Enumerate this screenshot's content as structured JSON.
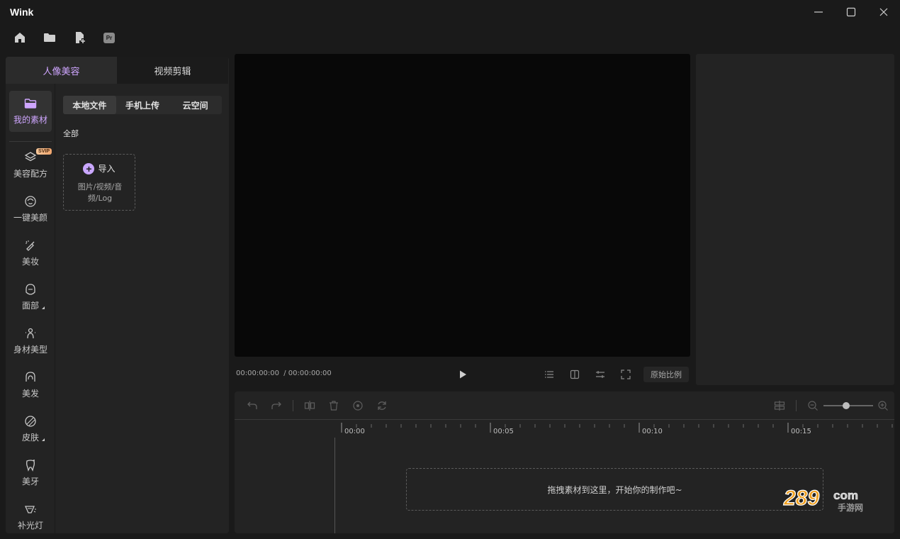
{
  "app": {
    "title": "Wink"
  },
  "window": {
    "minimize": "minimize",
    "maximize": "maximize",
    "close": "close"
  },
  "toolbar": {
    "icons": [
      "home-icon",
      "folder-icon",
      "new-file-icon",
      "premiere-icon"
    ],
    "pr_label": "Pr"
  },
  "top_tabs": [
    {
      "label": "人像美容",
      "active": true
    },
    {
      "label": "视频剪辑",
      "active": false
    }
  ],
  "sidebar": {
    "items": [
      {
        "label": "我的素材",
        "icon": "folder-open-icon",
        "active": true
      },
      {
        "label": "美容配方",
        "icon": "layers-icon",
        "badge": "SVIP"
      },
      {
        "label": "一键美颜",
        "icon": "face-icon"
      },
      {
        "label": "美妆",
        "icon": "makeup-brush-icon"
      },
      {
        "label": "面部",
        "icon": "face-outline-icon"
      },
      {
        "label": "身材美型",
        "icon": "body-icon"
      },
      {
        "label": "美发",
        "icon": "hair-icon"
      },
      {
        "label": "皮肤",
        "icon": "skin-icon"
      },
      {
        "label": "美牙",
        "icon": "tooth-icon"
      },
      {
        "label": "补光灯",
        "icon": "light-icon"
      }
    ]
  },
  "source_tabs": [
    {
      "label": "本地文件",
      "active": true
    },
    {
      "label": "手机上传",
      "active": false
    },
    {
      "label": "云空间",
      "active": false
    }
  ],
  "category": "全部",
  "import": {
    "label": "导入",
    "desc": "图片/视频/音频/Log"
  },
  "preview": {
    "time_current": "00:00:00:00",
    "time_total": "/ 00:00:00:00",
    "ratio_label": "原始比例"
  },
  "timeline": {
    "ticks": [
      "00:00",
      "00:05",
      "00:10",
      "00:15"
    ],
    "drop_hint": "拖拽素材到这里，开始你的制作吧~",
    "zoom_level": 0.45
  },
  "watermark": {
    "text": "289.com",
    "sub": "手游网"
  },
  "colors": {
    "accent": "#cfa6ff",
    "bg": "#1a1a1a",
    "panel": "#232323"
  }
}
